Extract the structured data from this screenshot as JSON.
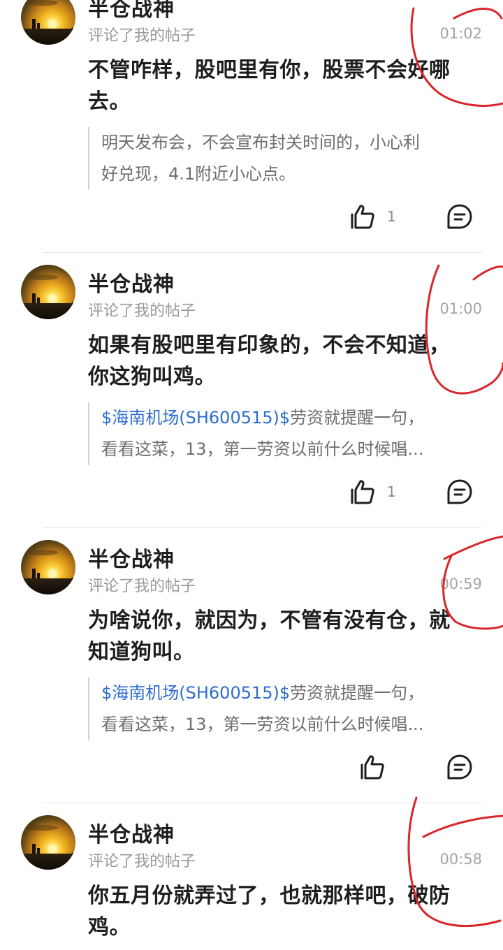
{
  "comments": [
    {
      "username": "半仓战神",
      "action": "评论了我的帖子",
      "time": "01:02",
      "content_lines": [
        "不管咋样，股吧里有你，股票不会好哪",
        "去。"
      ],
      "quote_mention": "",
      "quote_line1": "明天发布会，不会宣布封关时间的，小心利",
      "quote_line2": "好兑现，4.1附近小心点。",
      "likes": "1"
    },
    {
      "username": "半仓战神",
      "action": "评论了我的帖子",
      "time": "01:00",
      "content_lines": [
        "如果有股吧里有印象的，不会不知道，",
        "你这狗叫鸡。"
      ],
      "quote_mention": "$海南机场(SH600515)$",
      "quote_line1": "劳资就提醒一句，",
      "quote_line2": "看看这菜，13，第一劳资以前什么时候唱...",
      "likes": "1"
    },
    {
      "username": "半仓战神",
      "action": "评论了我的帖子",
      "time": "00:59",
      "content_lines": [
        "为啥说你，就因为，不管有没有仓，就",
        "知道狗叫。"
      ],
      "quote_mention": "$海南机场(SH600515)$",
      "quote_line1": "劳资就提醒一句，",
      "quote_line2": "看看这菜，13，第一劳资以前什么时候唱...",
      "likes": ""
    },
    {
      "username": "半仓战神",
      "action": "评论了我的帖子",
      "time": "00:58",
      "content_lines": [
        "你五月份就弄过了，也就那样吧，破防",
        "鸡。"
      ]
    }
  ],
  "icons": {
    "like": "thumbs-up-icon",
    "reply": "comment-bubble-icon"
  },
  "colors": {
    "mention": "#2c6ccf",
    "annotation": "#d9262b",
    "time": "#a4a4a4"
  }
}
